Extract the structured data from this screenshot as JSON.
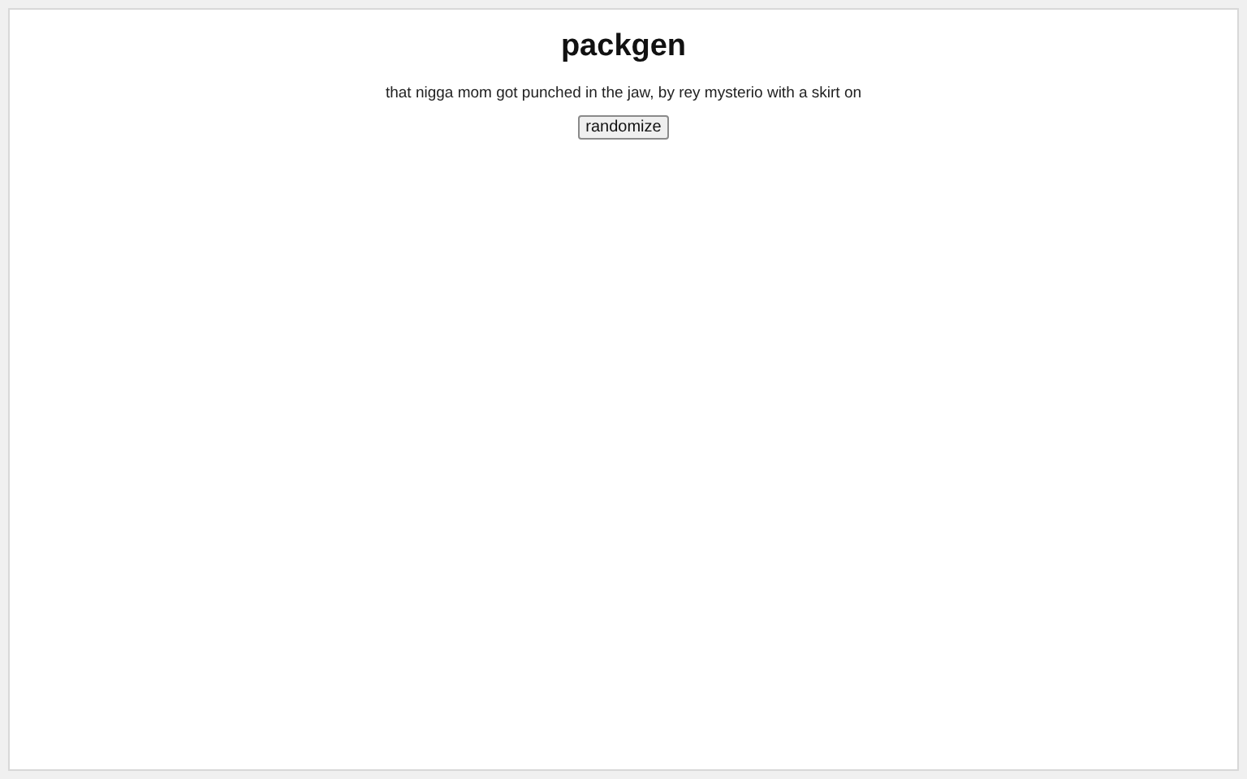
{
  "title": "packgen",
  "generated_text": "that nigga mom got punched in the jaw, by rey mysterio with a skirt on",
  "buttons": [
    "randomize"
  ]
}
